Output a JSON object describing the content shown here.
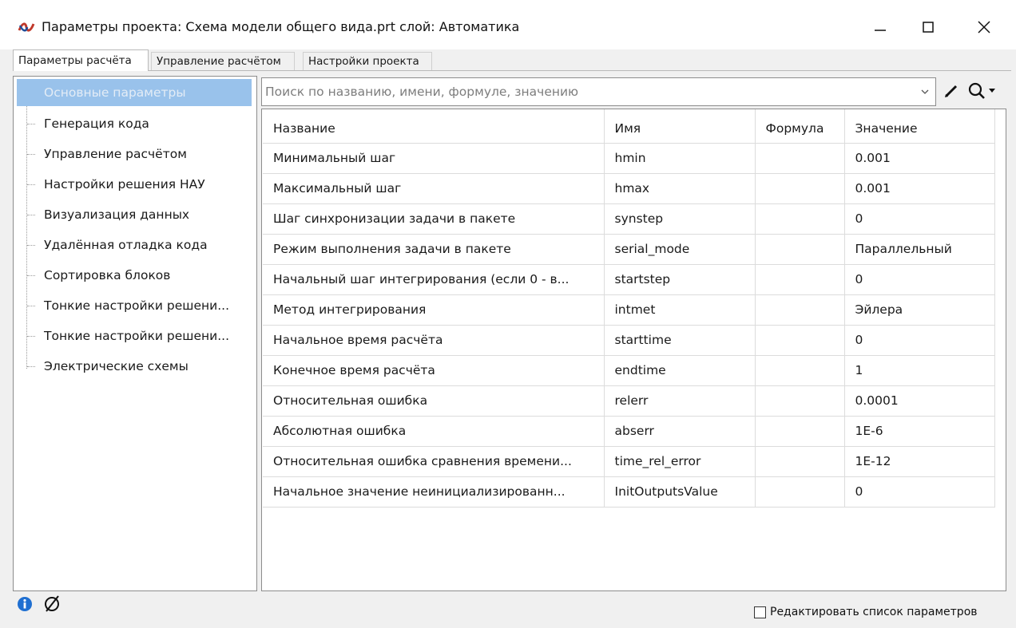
{
  "window": {
    "title": "Параметры проекта: Схема модели общего вида.prt  слой: Автоматика"
  },
  "tabs": [
    {
      "label": "Параметры расчёта",
      "active": true
    },
    {
      "label": "Управление расчётом",
      "active": false
    },
    {
      "label": "Настройки проекта",
      "active": false
    }
  ],
  "tree": {
    "items": [
      {
        "label": "Основные параметры",
        "selected": true
      },
      {
        "label": "Генерация кода"
      },
      {
        "label": "Управление расчётом"
      },
      {
        "label": "Настройки решения НАУ"
      },
      {
        "label": "Визуализация данных"
      },
      {
        "label": "Удалённая отладка кода"
      },
      {
        "label": "Сортировка блоков"
      },
      {
        "label": "Тонкие настройки решени..."
      },
      {
        "label": "Тонкие настройки решени..."
      },
      {
        "label": "Электрические схемы"
      }
    ]
  },
  "search": {
    "placeholder": "Поиск по названию, имени, формуле, значению",
    "value": ""
  },
  "table": {
    "columns": [
      "Название",
      "Имя",
      "Формула",
      "Значение"
    ],
    "rows": [
      [
        "Минимальный шаг",
        "hmin",
        "",
        "0.001"
      ],
      [
        "Максимальный шаг",
        "hmax",
        "",
        "0.001"
      ],
      [
        "Шаг синхронизации задачи в пакете",
        "synstep",
        "",
        "0"
      ],
      [
        "Режим выполнения задачи в пакете",
        "serial_mode",
        "",
        "Параллельный"
      ],
      [
        "Начальный шаг интегрирования (если 0 - в...",
        "startstep",
        "",
        "0"
      ],
      [
        "Метод интегрирования",
        "intmet",
        "",
        "Эйлера"
      ],
      [
        "Начальное время расчёта",
        "starttime",
        "",
        "0"
      ],
      [
        "Конечное время расчёта",
        "endtime",
        "",
        "1"
      ],
      [
        "Относительная ошибка",
        "relerr",
        "",
        "0.0001"
      ],
      [
        "Абсолютная ошибка",
        "abserr",
        "",
        "1E-6"
      ],
      [
        "Относительная ошибка сравнения времени...",
        "time_rel_error",
        "",
        "1E-12"
      ],
      [
        "Начальное значение неинициализированн...",
        "InitOutputsValue",
        "",
        "0"
      ]
    ]
  },
  "footer": {
    "edit_list_label": "Редактировать список параметров",
    "edit_list_checked": false
  },
  "colors": {
    "selection": "#99c2eb",
    "info_icon": "#1f6fd1"
  }
}
